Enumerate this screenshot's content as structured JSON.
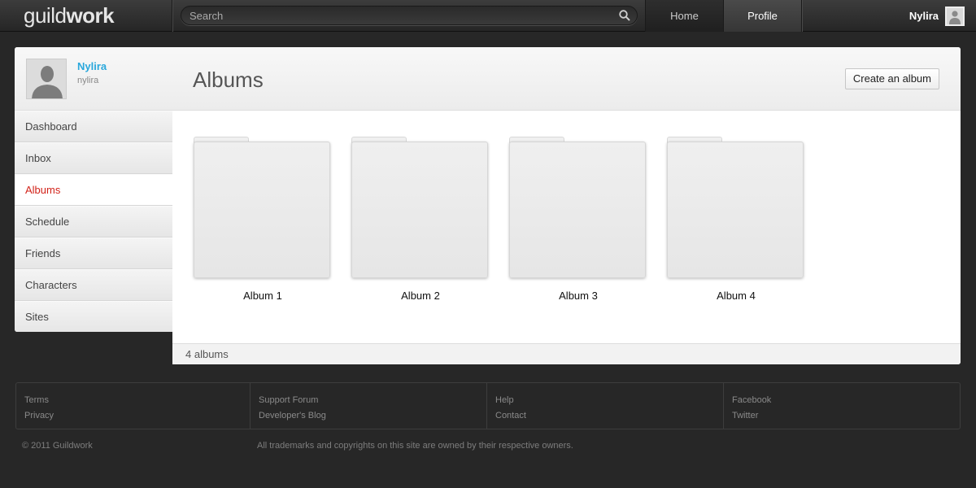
{
  "header": {
    "logo_part1": "guild",
    "logo_part2": "work",
    "search_placeholder": "Search",
    "nav_home": "Home",
    "nav_profile": "Profile",
    "username": "Nylira"
  },
  "sidebar": {
    "display_name": "Nylira",
    "handle": "nylira",
    "items": [
      {
        "label": "Dashboard"
      },
      {
        "label": "Inbox"
      },
      {
        "label": "Albums"
      },
      {
        "label": "Schedule"
      },
      {
        "label": "Friends"
      },
      {
        "label": "Characters"
      },
      {
        "label": "Sites"
      }
    ],
    "active_item": "Albums"
  },
  "main": {
    "title": "Albums",
    "create_button": "Create an album",
    "albums": [
      {
        "label": "Album 1"
      },
      {
        "label": "Album 2"
      },
      {
        "label": "Album 3"
      },
      {
        "label": "Album 4"
      }
    ],
    "footer_count": "4 albums"
  },
  "footer": {
    "columns": [
      {
        "links": [
          "Terms",
          "Privacy"
        ]
      },
      {
        "links": [
          "Support Forum",
          "Developer's Blog"
        ]
      },
      {
        "links": [
          "Help",
          "Contact"
        ]
      },
      {
        "links": [
          "Facebook",
          "Twitter"
        ]
      }
    ],
    "copyright": "© 2011 Guildwork",
    "trademark": "All trademarks and copyrights on this site are owned by their respective owners."
  },
  "colors": {
    "accent_blue": "#2aa8dc",
    "active_red": "#d2231a",
    "background": "#272727"
  }
}
